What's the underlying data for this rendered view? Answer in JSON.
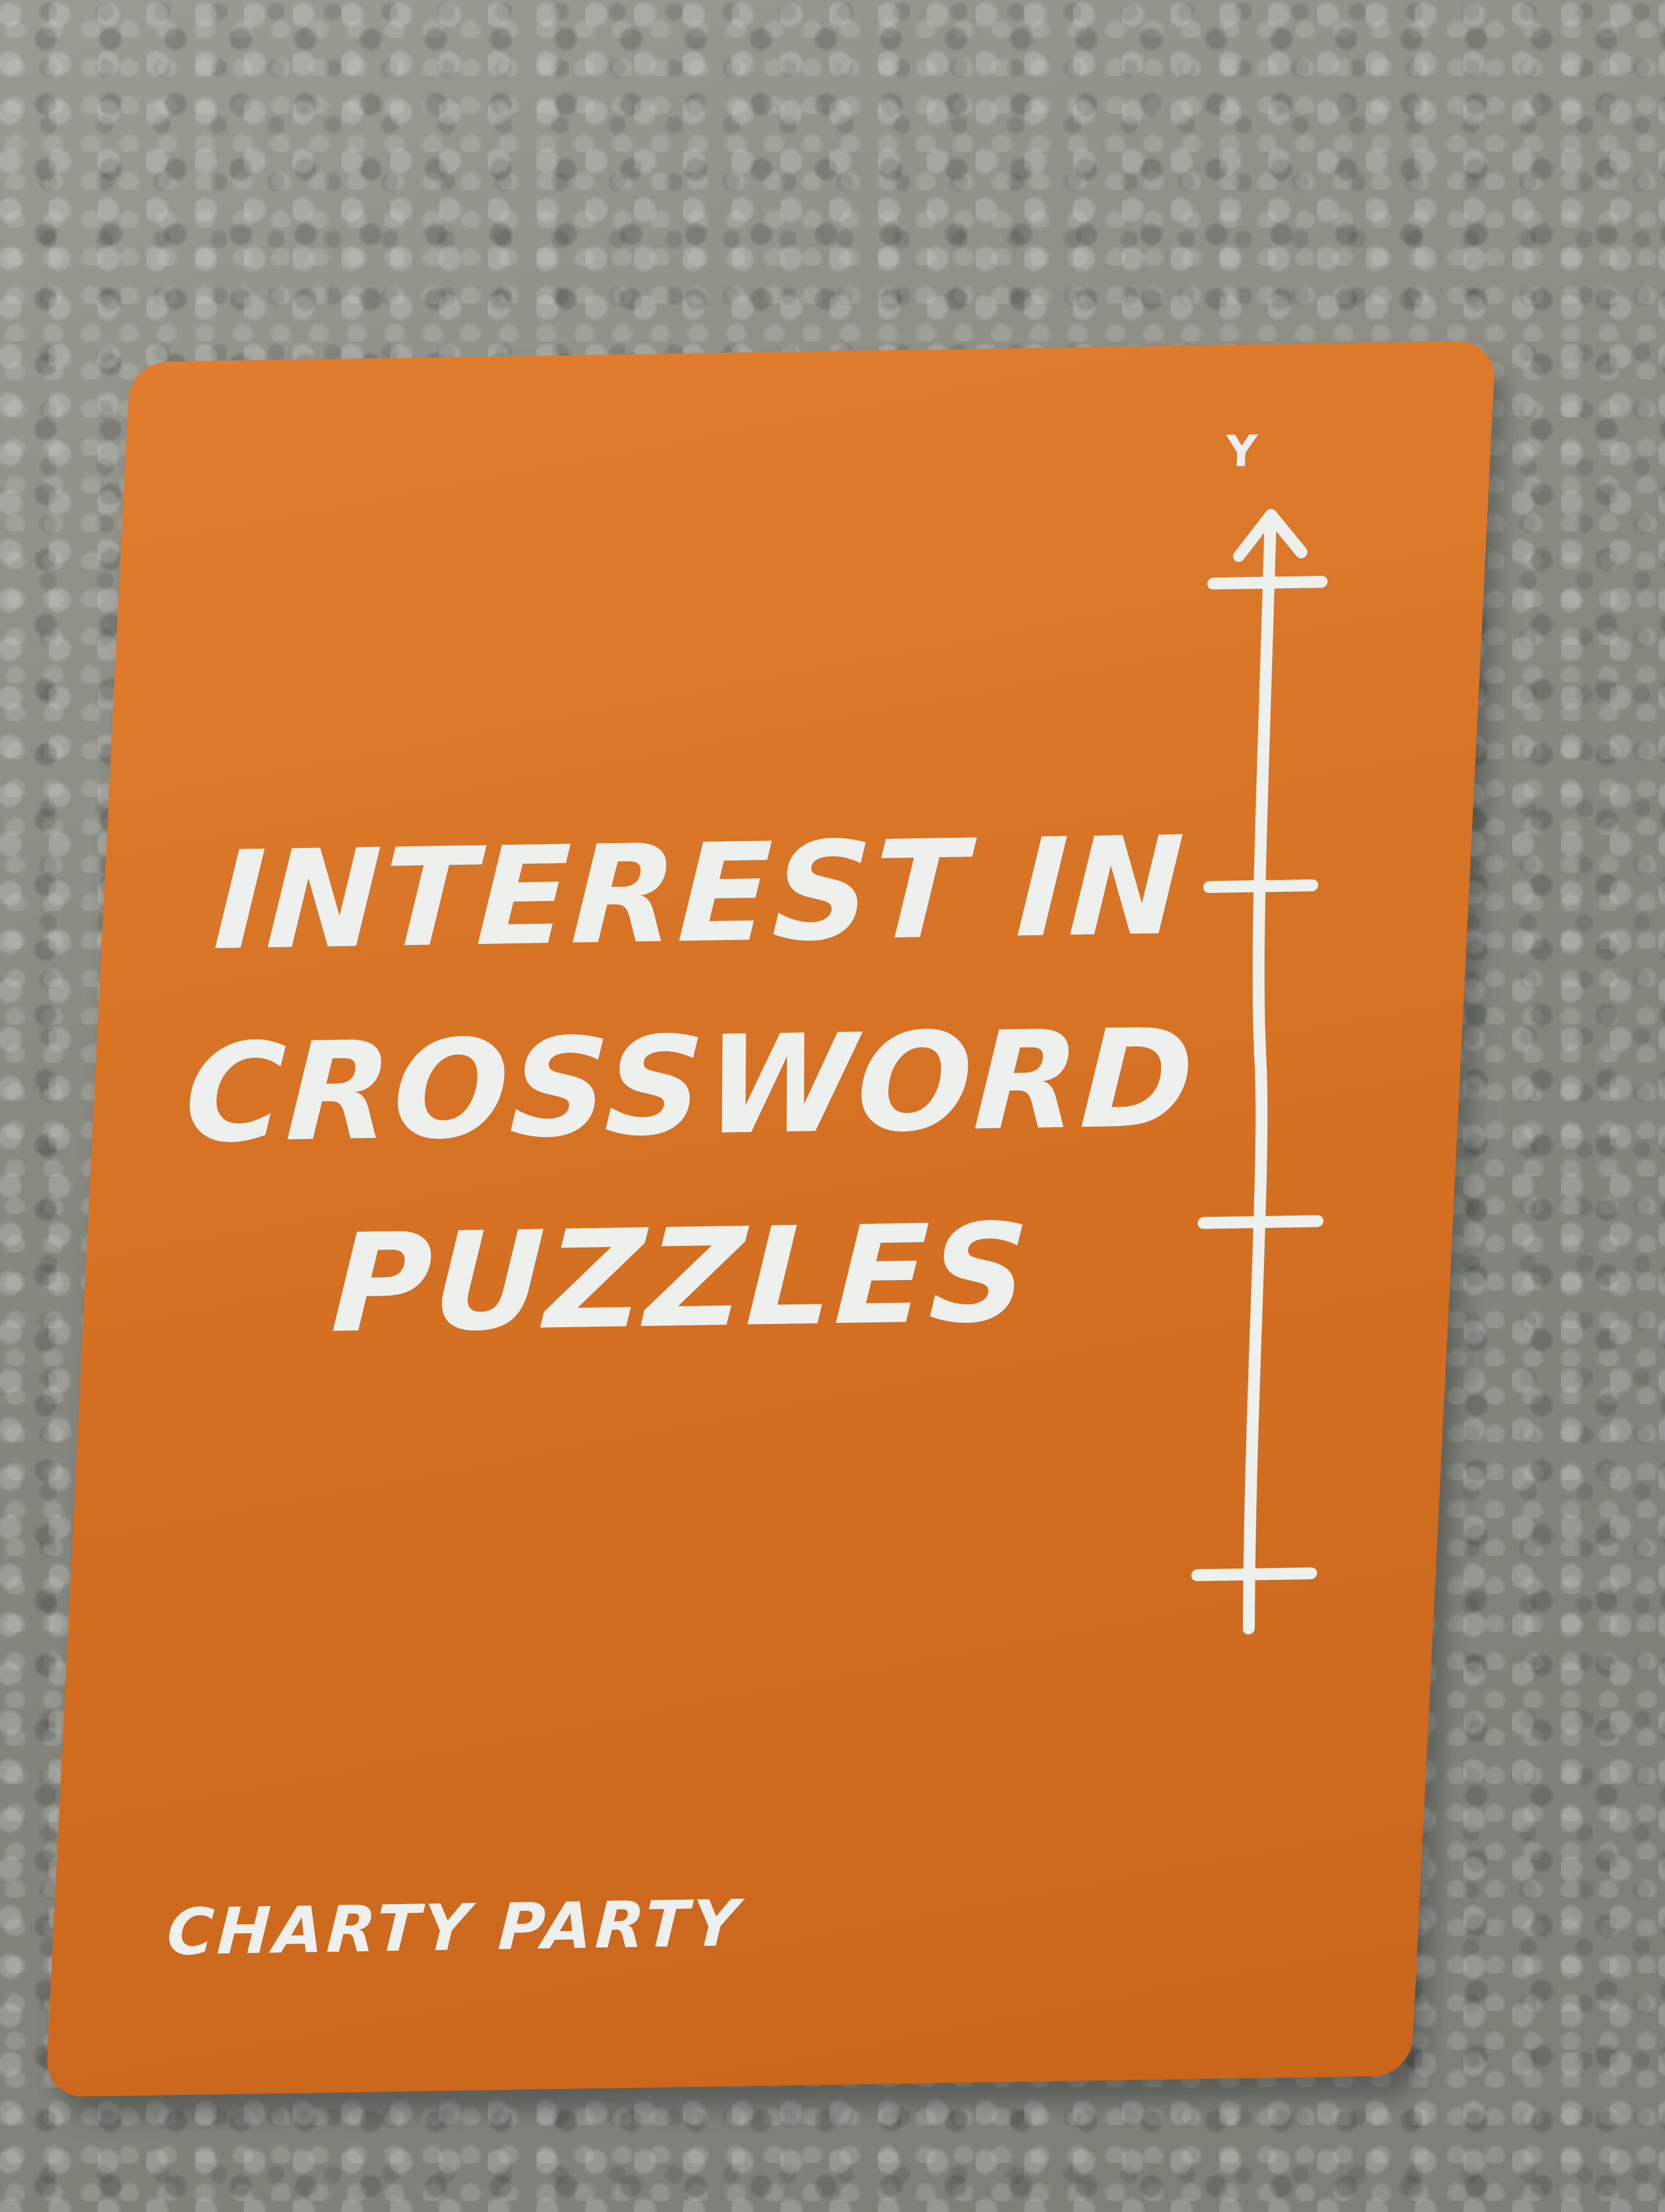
{
  "card": {
    "title_lines": [
      "INTEREST IN",
      "CROSSWORD",
      "PUZZLES"
    ],
    "brand": "CHARTY PARTY",
    "axis_label": "Y",
    "axis_tick_count": 4
  },
  "colors": {
    "card": "#d46f22",
    "text": "#eef0ee",
    "carpet": "#8f9189"
  }
}
